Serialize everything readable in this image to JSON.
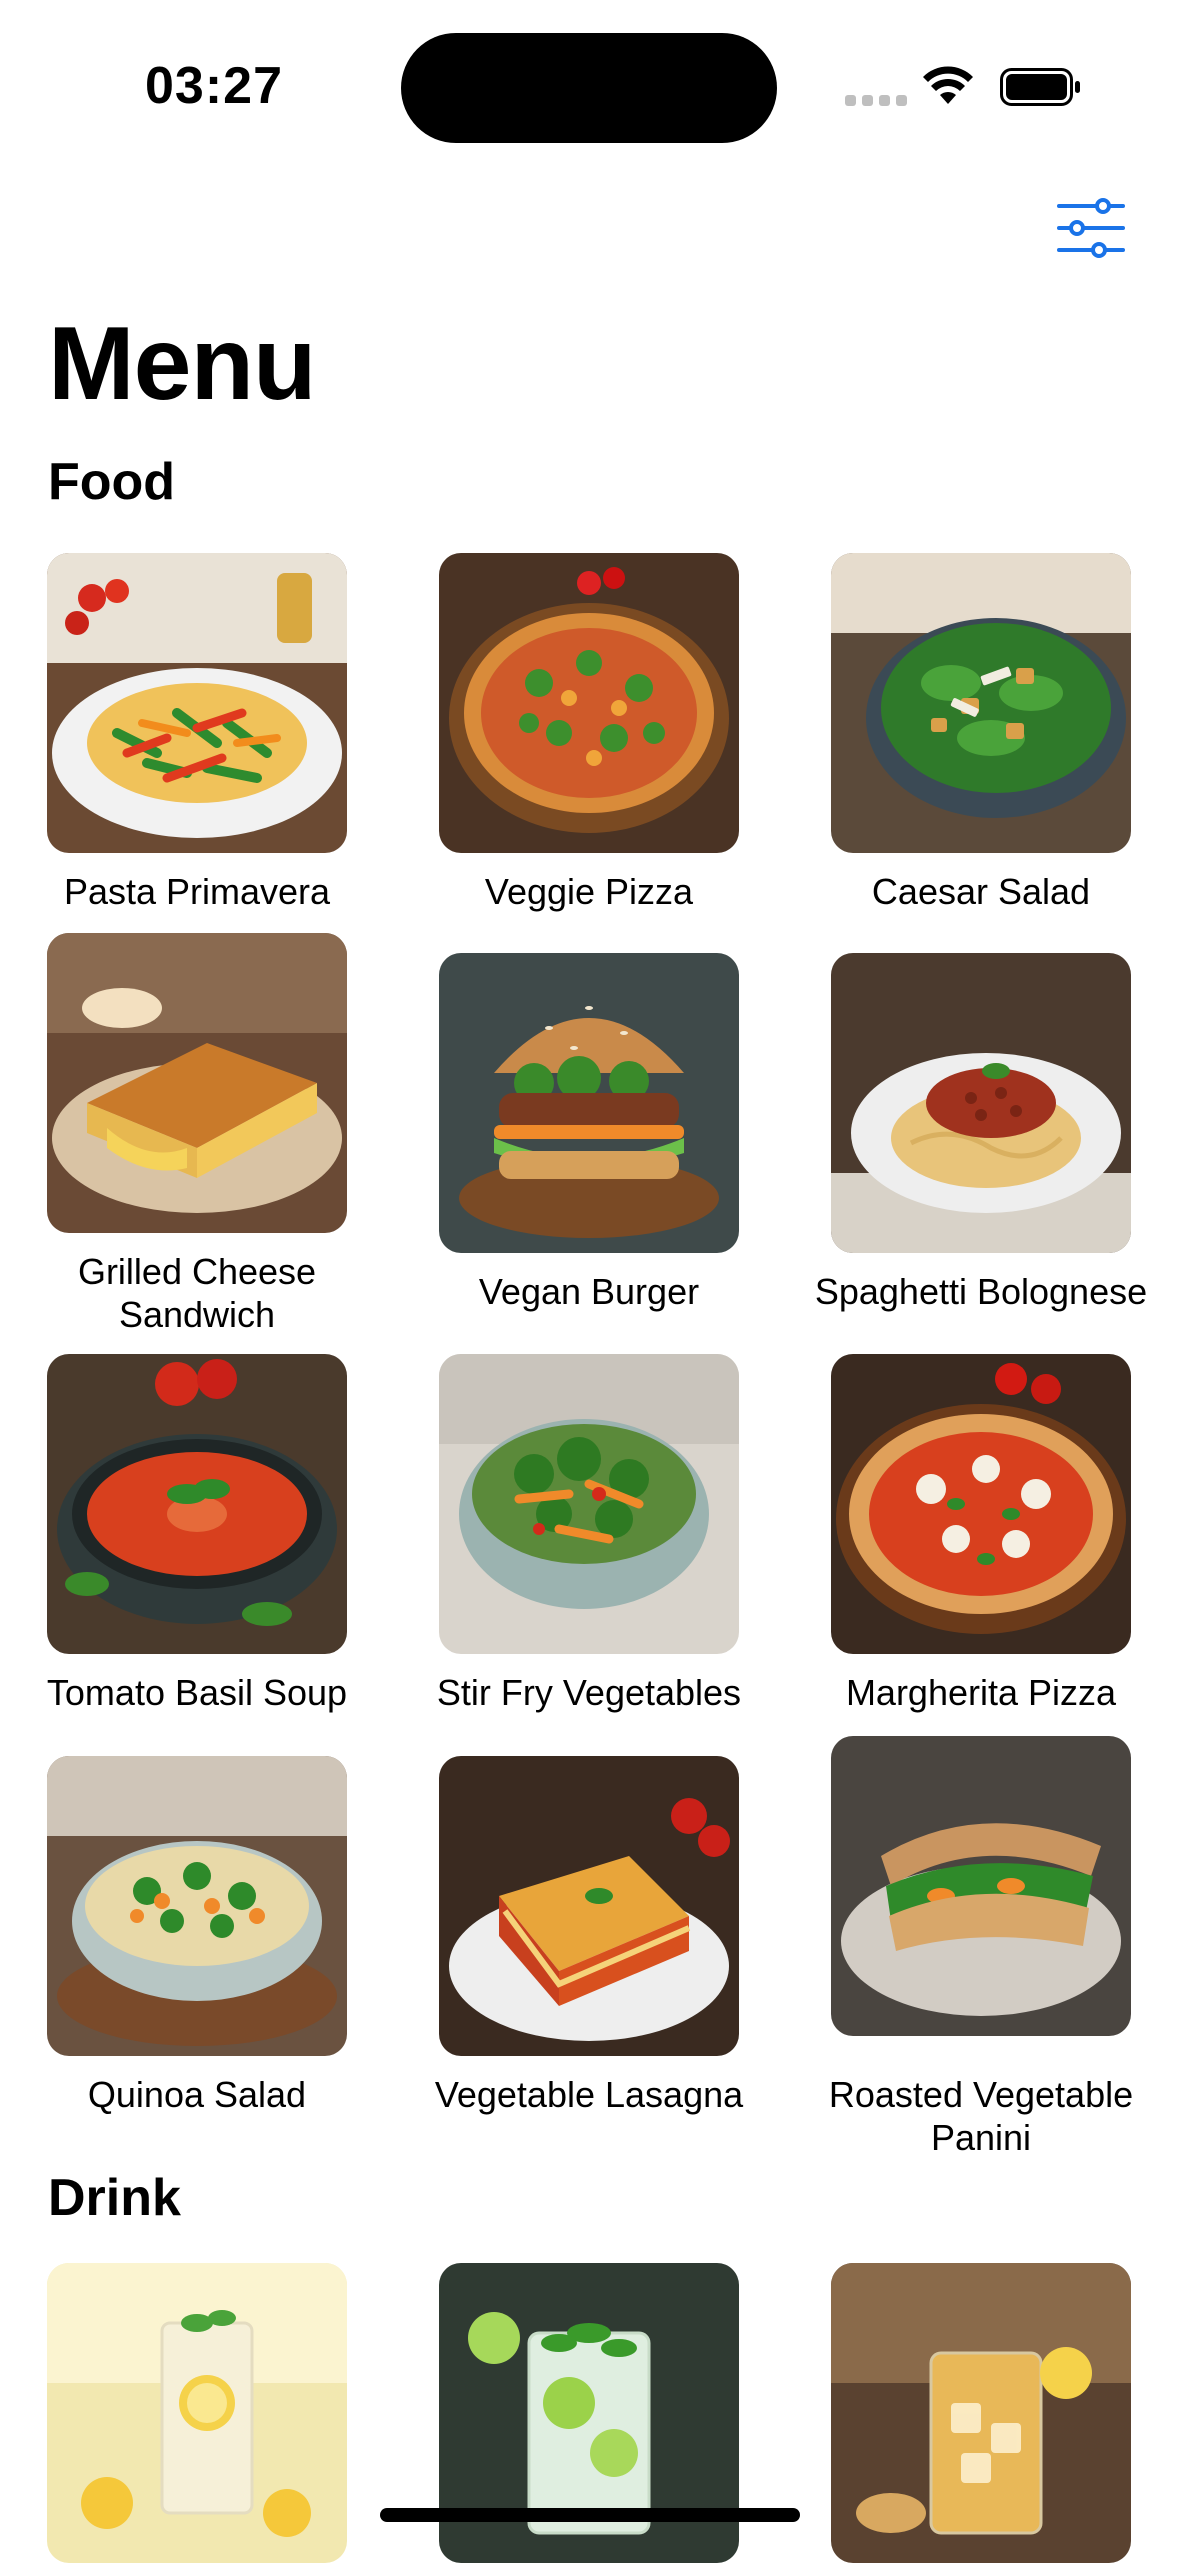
{
  "status_bar": {
    "time": "03:27"
  },
  "header": {
    "filter_icon": "sliders-icon",
    "accent_color": "#1a73e8"
  },
  "page": {
    "title": "Menu"
  },
  "sections": {
    "food": {
      "title": "Food",
      "items": [
        {
          "name": "Pasta Primavera",
          "icon": "pasta-image"
        },
        {
          "name": "Veggie Pizza",
          "icon": "pizza-image"
        },
        {
          "name": "Caesar Salad",
          "icon": "salad-image"
        },
        {
          "name": "Grilled Cheese Sandwich",
          "icon": "sandwich-image"
        },
        {
          "name": "Vegan Burger",
          "icon": "burger-image"
        },
        {
          "name": "Spaghetti Bolognese",
          "icon": "spaghetti-image"
        },
        {
          "name": "Tomato Basil Soup",
          "icon": "soup-image"
        },
        {
          "name": "Stir Fry Vegetables",
          "icon": "stir-fry-image"
        },
        {
          "name": "Margherita Pizza",
          "icon": "pizza-image"
        },
        {
          "name": "Quinoa Salad",
          "icon": "quinoa-image"
        },
        {
          "name": "Vegetable Lasagna",
          "icon": "lasagna-image"
        },
        {
          "name": "Roasted Vegetable Panini",
          "icon": "panini-image"
        }
      ]
    },
    "drink": {
      "title": "Drink",
      "items": [
        {
          "name": "",
          "icon": "lemonade-image"
        },
        {
          "name": "",
          "icon": "mojito-image"
        },
        {
          "name": "",
          "icon": "ginger-drink-image"
        }
      ]
    }
  }
}
